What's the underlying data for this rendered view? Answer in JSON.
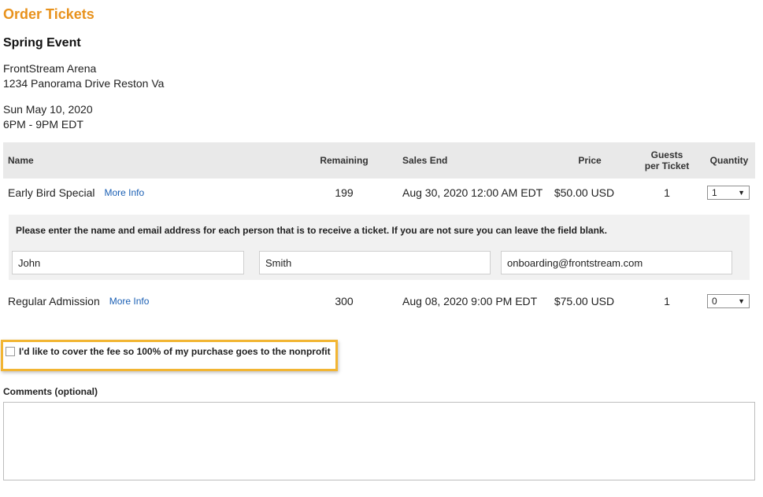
{
  "page": {
    "title": "Order Tickets"
  },
  "event": {
    "name": "Spring Event",
    "venue_name": "FrontStream Arena",
    "venue_address": "1234 Panorama Drive Reston Va",
    "date": "Sun May 10, 2020",
    "time": "6PM - 9PM EDT"
  },
  "table": {
    "headers": {
      "name": "Name",
      "remaining": "Remaining",
      "sales_end": "Sales End",
      "price": "Price",
      "guests_line1": "Guests",
      "guests_line2": "per Ticket",
      "quantity": "Quantity"
    },
    "rows": [
      {
        "name": "Early Bird Special",
        "more_info": "More Info",
        "remaining": "199",
        "sales_end": "Aug 30, 2020 12:00 AM EDT",
        "price": "$50.00 USD",
        "guests": "1",
        "quantity": "1"
      },
      {
        "name": "Regular Admission",
        "more_info": "More Info",
        "remaining": "300",
        "sales_end": "Aug 08, 2020 9:00 PM EDT",
        "price": "$75.00 USD",
        "guests": "1",
        "quantity": "0"
      }
    ]
  },
  "attendee": {
    "instructions": "Please enter the name and email address for each person that is to receive a ticket. If you are not sure you can leave the field blank.",
    "first_name": "John",
    "last_name": "Smith",
    "email": "onboarding@frontstream.com"
  },
  "fee": {
    "label": "I'd like to cover the fee so 100% of my purchase goes to the nonprofit",
    "checked": false
  },
  "comments": {
    "label": "Comments (optional)",
    "value": ""
  },
  "colors": {
    "title": "#e8921c",
    "link": "#1a5fb4",
    "highlight": "#f2b533",
    "header_bg": "#e9e9e9",
    "panel_bg": "#f1f1f1"
  },
  "icons": {
    "select_arrow": "chevron-down-icon"
  }
}
